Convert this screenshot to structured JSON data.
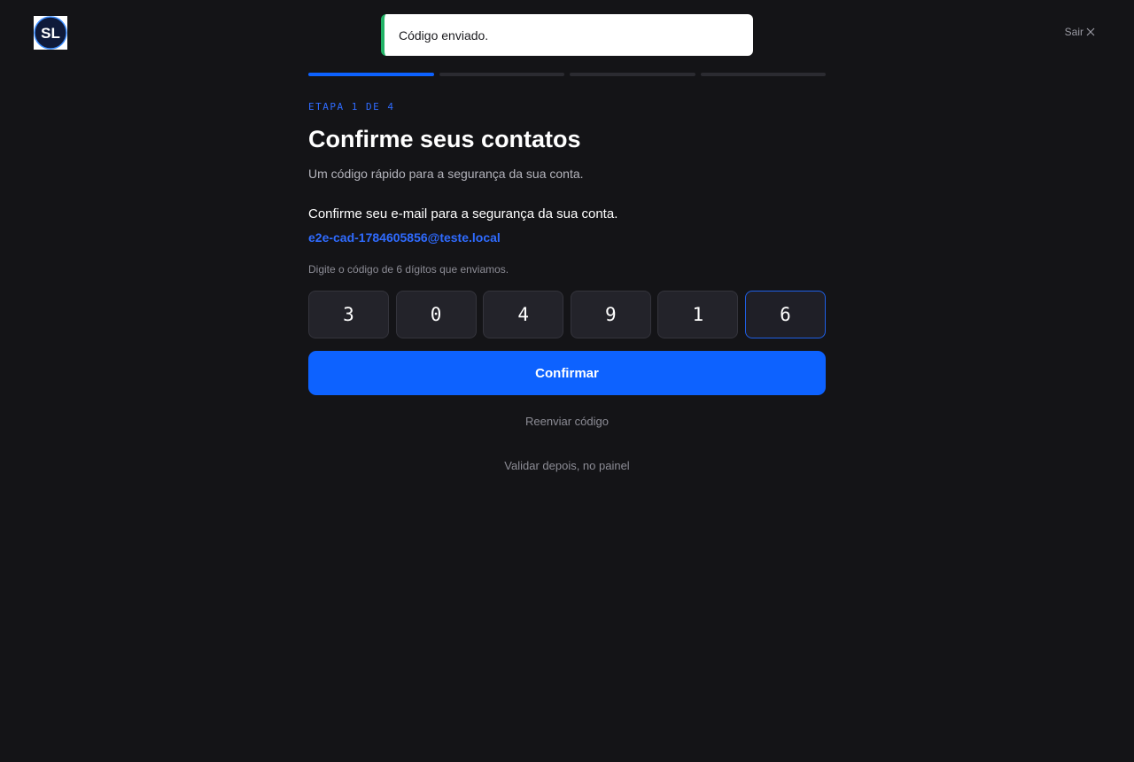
{
  "header": {
    "logo_text": "SL",
    "exit_label": "Sair"
  },
  "toast": {
    "message": "Código enviado.",
    "accent_color": "#22b266"
  },
  "progress": {
    "current_step": 1,
    "total_steps": 4,
    "accent_color": "#0d62ff"
  },
  "step": {
    "label": "ETAPA 1 DE 4",
    "title": "Confirme seus contatos",
    "subtitle": "Um código rápido para a segurança da sua conta."
  },
  "verification": {
    "instruction": "Confirme seu e-mail para a segurança da sua conta.",
    "email": "e2e-cad-1784605856@teste.local",
    "code_hint": "Digite o código de 6 dígitos que enviamos.",
    "digits": [
      "3",
      "0",
      "4",
      "9",
      "1",
      "6"
    ]
  },
  "actions": {
    "confirm_label": "Confirmar",
    "resend_label": "Reenviar código",
    "later_label": "Validar depois, no painel"
  },
  "icons": {
    "exit": "close-icon"
  }
}
